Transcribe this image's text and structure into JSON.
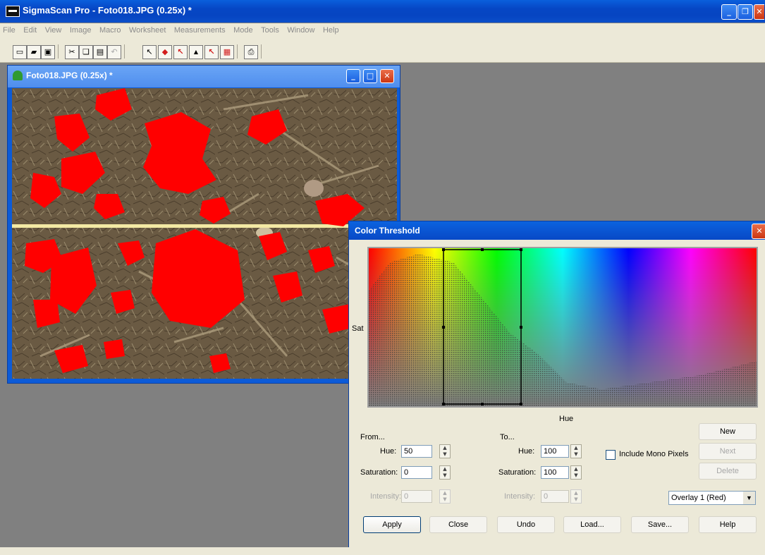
{
  "app": {
    "title": "SigmaScan Pro - Foto018.JPG (0.25x) *",
    "menu": [
      "File",
      "Edit",
      "View",
      "Image",
      "Macro",
      "Worksheet",
      "Measurements",
      "Mode",
      "Tools",
      "Window",
      "Help"
    ],
    "window_buttons": {
      "minimize": "_",
      "restore": "❐",
      "close": "✕"
    }
  },
  "image_window": {
    "title": "Foto018.JPG (0.25x) *",
    "buttons": {
      "minimize": "_",
      "maximize": "□",
      "close": "✕"
    }
  },
  "dialog": {
    "title": "Color Threshold",
    "close": "✕",
    "spectrum": {
      "y_label": "Sat",
      "x_label": "Hue"
    },
    "from": {
      "header": "From...",
      "hue_label": "Hue:",
      "hue": "50",
      "sat_label": "Saturation:",
      "sat": "0",
      "int_label": "Intensity:",
      "int": "0"
    },
    "to": {
      "header": "To...",
      "hue_label": "Hue:",
      "hue": "100",
      "sat_label": "Saturation:",
      "sat": "100",
      "int_label": "Intensity:",
      "int": "0"
    },
    "mono_label": "Include Mono Pixels",
    "buttons": {
      "new": "New",
      "next": "Next",
      "delete": "Delete",
      "apply": "Apply",
      "close": "Close",
      "undo": "Undo",
      "load": "Load...",
      "save": "Save...",
      "help": "Help"
    },
    "overlay": "Overlay 1 (Red)"
  },
  "colors": {
    "title_blue": "#0646c4",
    "overlay_red": "#ff0000",
    "dialog_bg": "#ece9d8"
  }
}
